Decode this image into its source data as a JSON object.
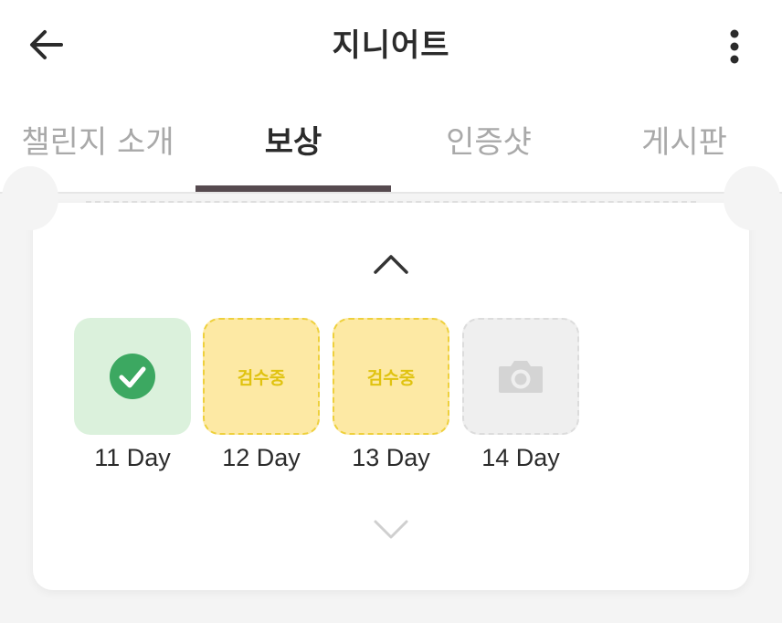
{
  "header": {
    "title": "지니어트"
  },
  "tabs": [
    {
      "label": "챌린지 소개",
      "active": false
    },
    {
      "label": "보상",
      "active": true
    },
    {
      "label": "인증샷",
      "active": false
    },
    {
      "label": "게시판",
      "active": false
    }
  ],
  "days": [
    {
      "label": "11 Day",
      "status": "done",
      "icon": "check-circle-icon"
    },
    {
      "label": "12 Day",
      "status": "review",
      "status_text": "검수중"
    },
    {
      "label": "13 Day",
      "status": "review",
      "status_text": "검수중"
    },
    {
      "label": "14 Day",
      "status": "empty",
      "icon": "camera-icon"
    }
  ],
  "colors": {
    "done_bg": "#dbf1dc",
    "check_green": "#3ca861",
    "review_bg": "#fde9a4",
    "review_text": "#e0c310",
    "empty_bg": "#efefef",
    "tab_indicator": "#564a4f"
  }
}
